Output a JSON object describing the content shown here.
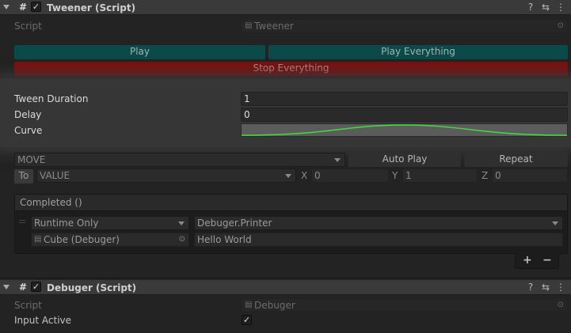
{
  "tweener": {
    "title": "Tweener (Script)",
    "script_label": "Script",
    "script_value": "Tweener",
    "play_label": "Play",
    "play_everything_label": "Play Everything",
    "stop_everything_label": "Stop Everything",
    "tween_duration_label": "Tween Duration",
    "tween_duration_value": "1",
    "delay_label": "Delay",
    "delay_value": "0",
    "curve_label": "Curve",
    "mode_value": "MOVE",
    "auto_play_label": "Auto Play",
    "repeat_label": "Repeat",
    "to_label": "To",
    "target_value": "VALUE",
    "x_label": "X",
    "x_value": "0",
    "y_label": "Y",
    "y_value": "1",
    "z_label": "Z",
    "z_value": "0",
    "event": {
      "header": "Completed ()",
      "runtime_value": "Runtime Only",
      "function_value": "Debuger.Printer",
      "object_value": "Cube (Debuger)",
      "argument_value": "Hello World",
      "add_label": "+",
      "remove_label": "−"
    }
  },
  "debuger": {
    "title": "Debuger (Script)",
    "script_label": "Script",
    "script_value": "Debuger",
    "input_active_label": "Input Active",
    "input_active_checked": true
  },
  "colors": {
    "play": "#0c4a4a",
    "stop": "#7a1010",
    "curve_line": "#3fdc3f"
  }
}
